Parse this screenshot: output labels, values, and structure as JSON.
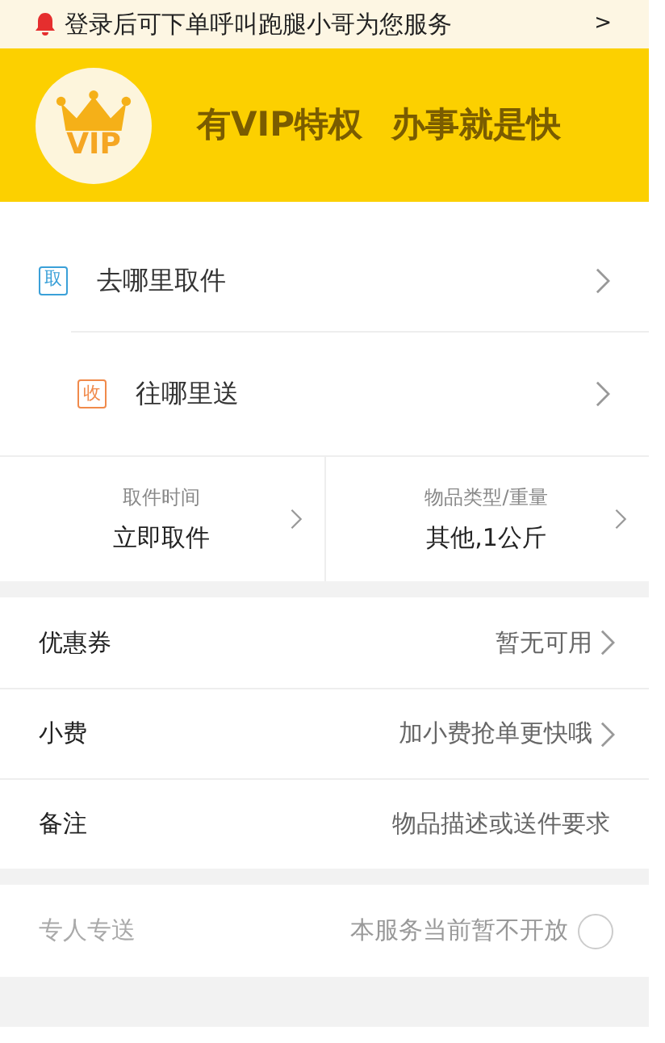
{
  "notice": {
    "text": "登录后可下单呼叫跑腿小哥为您服务",
    "arrow": ">"
  },
  "banner": {
    "badge": "VIP",
    "slogan_1": "有VIP特权",
    "slogan_2": "办事就是快"
  },
  "address_rows": [
    {
      "tag": "取",
      "color": "#3aa0d8",
      "label": "去哪里取件"
    },
    {
      "tag": "收",
      "color": "#f08a4b",
      "label": "往哪里送"
    }
  ],
  "options": [
    {
      "caption": "取件时间",
      "value": "立即取件"
    },
    {
      "caption": "物品类型/重量",
      "value": "其他,1公斤"
    }
  ],
  "detail_rows": [
    {
      "label": "优惠券",
      "value": "暂无可用",
      "kind": "arrow"
    },
    {
      "label": "小费",
      "value": "加小费抢单更快哦",
      "kind": "arrow"
    },
    {
      "label": "备注",
      "value": "物品描述或送件要求",
      "kind": "plain"
    }
  ],
  "dedicated": {
    "label": "专人专送",
    "note": "本服务当前暂不开放",
    "checked": false,
    "disabled": true
  }
}
